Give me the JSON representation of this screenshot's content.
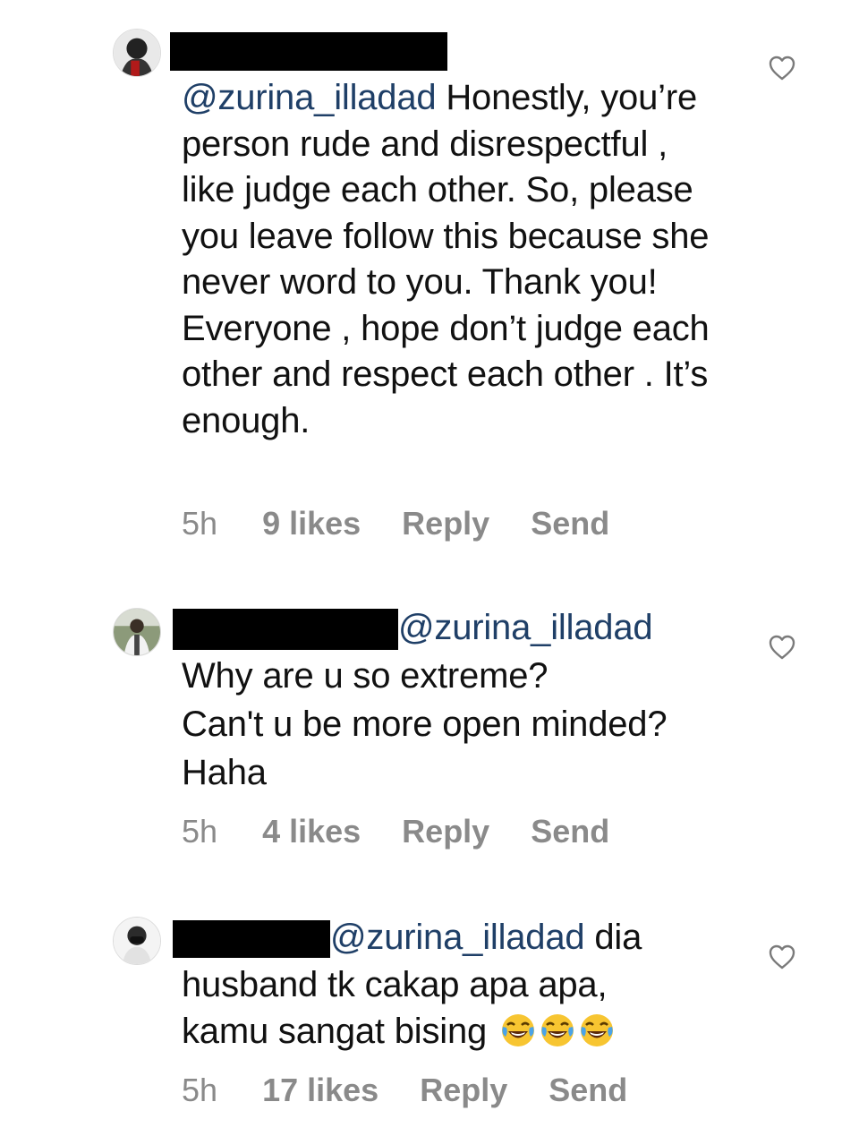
{
  "comments": [
    {
      "mention": "@zurina_illadad",
      "text": "Honestly, you’re person rude and disrespectful , like judge each other. So, please you leave follow this because she never word to you. Thank you! Everyone , hope don’t judge each other and respect each other . It’s enough.",
      "time": "5h",
      "likes": "9 likes",
      "reply": "Reply",
      "send": "Send"
    },
    {
      "mention": "@zurina_illadad",
      "line1": "Why are u so extreme?",
      "line2": "Can't u be more open minded?",
      "line3": "Haha",
      "time": "5h",
      "likes": "4 likes",
      "reply": "Reply",
      "send": "Send"
    },
    {
      "mention": "@zurina_illadad",
      "text_start": "dia",
      "line2": "husband tk cakap apa apa,",
      "line3": "kamu sangat bising",
      "emoji_name": "face-with-tears-of-joy",
      "time": "5h",
      "likes": "17 likes",
      "reply": "Reply",
      "send": "Send"
    }
  ],
  "colors": {
    "mention": "#1f3f67",
    "meta_text": "#8a8a8a",
    "text": "#111111",
    "redaction": "#000000"
  },
  "icons": {
    "like": "heart-outline-icon",
    "emoji": "face-with-tears-of-joy"
  }
}
